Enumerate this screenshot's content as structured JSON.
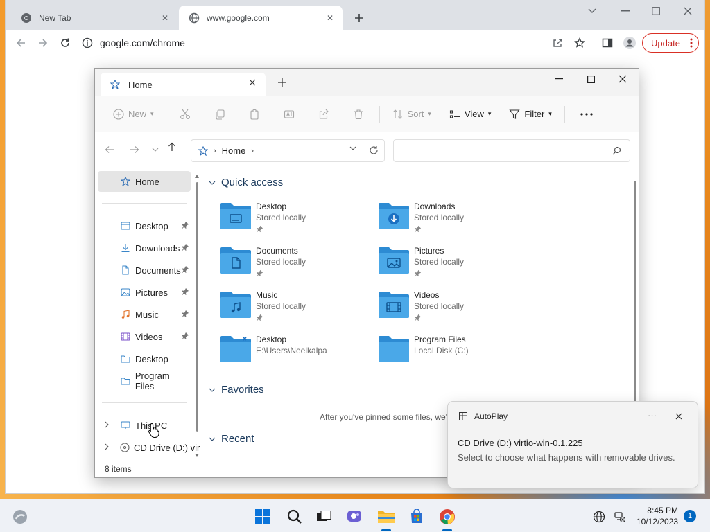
{
  "chrome": {
    "tabs": [
      {
        "title": "New Tab"
      },
      {
        "title": "www.google.com"
      }
    ],
    "address": "google.com/chrome",
    "update_label": "Update"
  },
  "explorer": {
    "tab_title": "Home",
    "commands": {
      "new": "New",
      "sort": "Sort",
      "view": "View",
      "filter": "Filter"
    },
    "breadcrumb": "Home",
    "sidebar": {
      "home": "Home",
      "pinned": [
        {
          "label": "Desktop",
          "icon": "desktop-icon"
        },
        {
          "label": "Downloads",
          "icon": "downloads-icon"
        },
        {
          "label": "Documents",
          "icon": "documents-icon"
        },
        {
          "label": "Pictures",
          "icon": "pictures-icon"
        },
        {
          "label": "Music",
          "icon": "music-icon"
        },
        {
          "label": "Videos",
          "icon": "videos-icon"
        },
        {
          "label": "Desktop",
          "icon": "folder-icon"
        },
        {
          "label": "Program Files",
          "icon": "folder-icon"
        }
      ],
      "this_pc": "This PC",
      "cd_drive": "CD Drive (D:) vir"
    },
    "sections": {
      "quick_access": "Quick access",
      "favorites": "Favorites",
      "recent": "Recent"
    },
    "quick_access": [
      {
        "name": "Desktop",
        "sub": "Stored locally",
        "pinned": true,
        "glyph": "desktop"
      },
      {
        "name": "Downloads",
        "sub": "Stored locally",
        "pinned": true,
        "glyph": "download"
      },
      {
        "name": "Documents",
        "sub": "Stored locally",
        "pinned": true,
        "glyph": "document"
      },
      {
        "name": "Pictures",
        "sub": "Stored locally",
        "pinned": true,
        "glyph": "picture"
      },
      {
        "name": "Music",
        "sub": "Stored locally",
        "pinned": true,
        "glyph": "music"
      },
      {
        "name": "Videos",
        "sub": "Stored locally",
        "pinned": true,
        "glyph": "video"
      },
      {
        "name": "Desktop",
        "sub": "E:\\Users\\Neelkalpa",
        "pinned": false,
        "glyph": "shortcut"
      },
      {
        "name": "Program Files",
        "sub": "Local Disk (C:)",
        "pinned": false,
        "glyph": "none"
      }
    ],
    "favorites_empty": "After you've pinned some files, we'",
    "status": "8 items"
  },
  "toast": {
    "app": "AutoPlay",
    "more": "···",
    "title": "CD Drive (D:) virtio-win-0.1.225",
    "body": "Select to choose what happens with removable drives."
  },
  "taskbar": {
    "time": "8:45 PM",
    "date": "10/12/2023",
    "notifications": "1"
  },
  "colors": {
    "folder": "#4aa8e8",
    "folder_dark": "#2d8bd3",
    "accent": "#0067c0",
    "update": "#d93025"
  }
}
